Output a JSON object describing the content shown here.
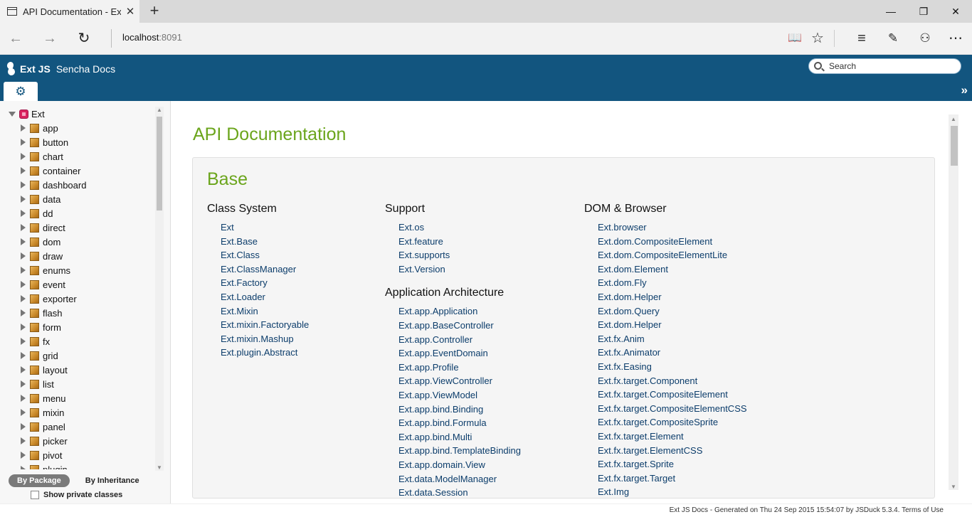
{
  "browser": {
    "tab_title": "API Documentation - Ex",
    "tab_close": "✕",
    "new_tab": "+",
    "min": "—",
    "restore": "❐",
    "close": "✕",
    "back": "←",
    "forward": "→",
    "refresh": "↻",
    "address_host": "localhost",
    "address_port": ":8091",
    "reading_view": "📖",
    "favorite": "☆",
    "hub": "≡",
    "note": "✎",
    "share": "⚇",
    "more": "⋯"
  },
  "header": {
    "brand": "Ext JS",
    "site": "Sencha Docs",
    "search_placeholder": "Search",
    "gear": "⚙",
    "collapse": "»"
  },
  "sidebar": {
    "root": "Ext",
    "packages": [
      "app",
      "button",
      "chart",
      "container",
      "dashboard",
      "data",
      "dd",
      "direct",
      "dom",
      "draw",
      "enums",
      "event",
      "exporter",
      "flash",
      "form",
      "fx",
      "grid",
      "layout",
      "list",
      "menu",
      "mixin",
      "panel",
      "picker",
      "pivot",
      "plugin"
    ],
    "by_package": "By Package",
    "by_inheritance": "By Inheritance",
    "show_private": "Show private classes"
  },
  "main": {
    "title": "API Documentation",
    "section": "Base",
    "columns": [
      {
        "groups": [
          {
            "heading": "Class System",
            "links": [
              "Ext",
              "Ext.Base",
              "Ext.Class",
              "Ext.ClassManager",
              "Ext.Factory",
              "Ext.Loader",
              "Ext.Mixin",
              "Ext.mixin.Factoryable",
              "Ext.mixin.Mashup",
              "Ext.plugin.Abstract"
            ]
          }
        ]
      },
      {
        "groups": [
          {
            "heading": "Support",
            "links": [
              "Ext.os",
              "Ext.feature",
              "Ext.supports",
              "Ext.Version"
            ]
          },
          {
            "heading": "Application Architecture",
            "links": [
              "Ext.app.Application",
              "Ext.app.BaseController",
              "Ext.app.Controller",
              "Ext.app.EventDomain",
              "Ext.app.Profile",
              "Ext.app.ViewController",
              "Ext.app.ViewModel",
              "Ext.app.bind.Binding",
              "Ext.app.bind.Formula",
              "Ext.app.bind.Multi",
              "Ext.app.bind.TemplateBinding",
              "Ext.app.domain.View",
              "Ext.data.ModelManager",
              "Ext.data.Session"
            ]
          }
        ]
      },
      {
        "groups": [
          {
            "heading": "DOM & Browser",
            "links": [
              "Ext.browser",
              "Ext.dom.CompositeElement",
              "Ext.dom.CompositeElementLite",
              "Ext.dom.Element",
              "Ext.dom.Fly",
              "Ext.dom.Helper",
              "Ext.dom.Query",
              "Ext.dom.Helper",
              "Ext.fx.Anim",
              "Ext.fx.Animator",
              "Ext.fx.Easing",
              "Ext.fx.target.Component",
              "Ext.fx.target.CompositeElement",
              "Ext.fx.target.CompositeElementCSS",
              "Ext.fx.target.CompositeSprite",
              "Ext.fx.target.Element",
              "Ext.fx.target.ElementCSS",
              "Ext.fx.target.Sprite",
              "Ext.fx.target.Target",
              "Ext.Img"
            ]
          }
        ]
      }
    ]
  },
  "footer": {
    "text": "Ext JS Docs - Generated on Thu 24 Sep 2015 15:54:07 by JSDuck 5.3.4. Terms of Use"
  }
}
